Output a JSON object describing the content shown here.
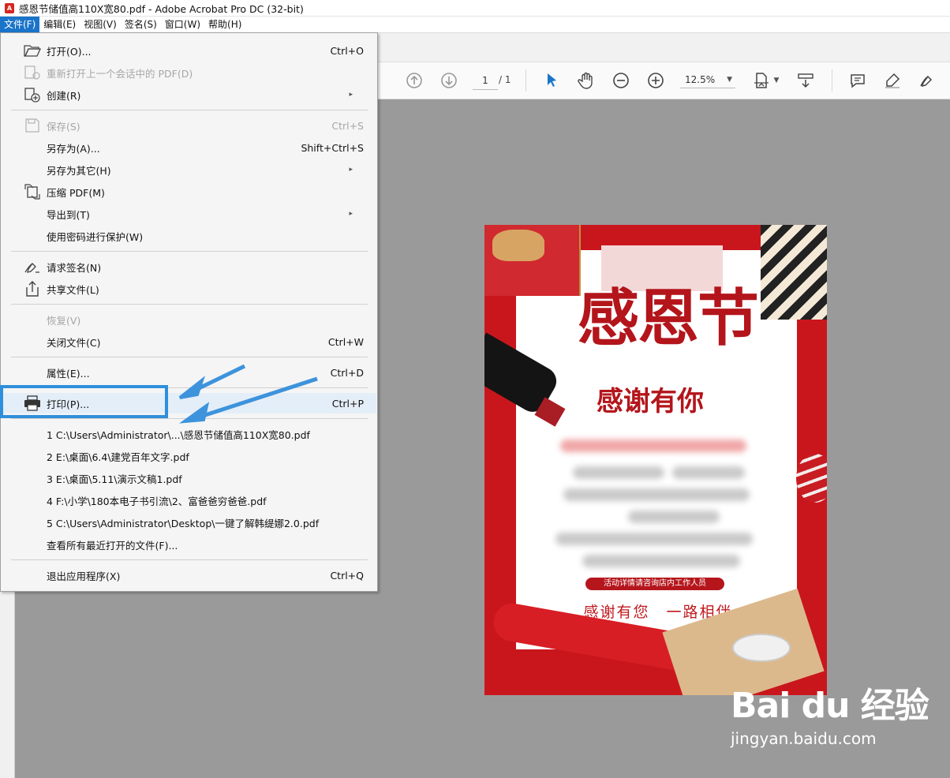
{
  "window": {
    "title": "感恩节储值高110X宽80.pdf - Adobe Acrobat Pro DC (32-bit)",
    "app_icon": "pdf-icon"
  },
  "menubar": {
    "items": [
      "文件(F)",
      "编辑(E)",
      "视图(V)",
      "签名(S)",
      "窗口(W)",
      "帮助(H)"
    ],
    "active_index": 0
  },
  "toolbar": {
    "page_current": "1",
    "page_total": "/ 1",
    "zoom": "12.5%"
  },
  "file_menu": {
    "items": [
      {
        "label": "打开(O)...",
        "shortcut": "Ctrl+O",
        "icon": "open-folder-icon",
        "enabled": true
      },
      {
        "label": "重新打开上一个会话中的 PDF(D)",
        "shortcut": "",
        "icon": "reopen-icon",
        "enabled": false
      },
      {
        "label": "创建(R)",
        "shortcut": "",
        "icon": "create-pdf-icon",
        "enabled": true,
        "submenu": true
      },
      {
        "label": "保存(S)",
        "shortcut": "Ctrl+S",
        "icon": "save-icon",
        "enabled": false
      },
      {
        "label": "另存为(A)...",
        "shortcut": "Shift+Ctrl+S",
        "enabled": true
      },
      {
        "label": "另存为其它(H)",
        "shortcut": "",
        "enabled": true,
        "submenu": true
      },
      {
        "label": "压缩 PDF(M)",
        "shortcut": "",
        "icon": "compress-icon",
        "enabled": true
      },
      {
        "label": "导出到(T)",
        "shortcut": "",
        "enabled": true,
        "submenu": true
      },
      {
        "label": "使用密码进行保护(W)",
        "shortcut": "",
        "enabled": true
      },
      {
        "label": "请求签名(N)",
        "shortcut": "",
        "icon": "sign-request-icon",
        "enabled": true
      },
      {
        "label": "共享文件(L)",
        "shortcut": "",
        "icon": "share-icon",
        "enabled": true
      },
      {
        "label": "恢复(V)",
        "shortcut": "",
        "enabled": false
      },
      {
        "label": "关闭文件(C)",
        "shortcut": "Ctrl+W",
        "enabled": true
      },
      {
        "label": "属性(E)...",
        "shortcut": "Ctrl+D",
        "enabled": true
      },
      {
        "label": "打印(P)...",
        "shortcut": "Ctrl+P",
        "icon": "printer-icon",
        "enabled": true,
        "highlighted": true
      },
      {
        "label": "1 C:\\Users\\Administrator\\...\\感恩节储值高110X宽80.pdf",
        "shortcut": "",
        "enabled": true
      },
      {
        "label": "2 E:\\桌面\\6.4\\建党百年文字.pdf",
        "shortcut": "",
        "enabled": true
      },
      {
        "label": "3 E:\\桌面\\5.11\\演示文稿1.pdf",
        "shortcut": "",
        "enabled": true
      },
      {
        "label": "4 F:\\小学\\180本电子书引流\\2、富爸爸穷爸爸.pdf",
        "shortcut": "",
        "enabled": true
      },
      {
        "label": "5 C:\\Users\\Administrator\\Desktop\\一键了解韩缇娜2.0.pdf",
        "shortcut": "",
        "enabled": true
      },
      {
        "label": "查看所有最近打开的文件(F)...",
        "shortcut": "",
        "enabled": true
      },
      {
        "label": "退出应用程序(X)",
        "shortcut": "Ctrl+Q",
        "enabled": true
      }
    ]
  },
  "document": {
    "headline": "感恩节",
    "subhead": "感谢有你",
    "pill_text": "活动详情请咨询店内工作人员",
    "slogan": "感谢有您　一路相伴"
  },
  "watermark": {
    "logo": "Bai du 经验",
    "url": "jingyan.baidu.com"
  },
  "colors": {
    "accent": "#1a74c9",
    "annotation": "#2f8fdb",
    "poster_red": "#c9161d"
  }
}
